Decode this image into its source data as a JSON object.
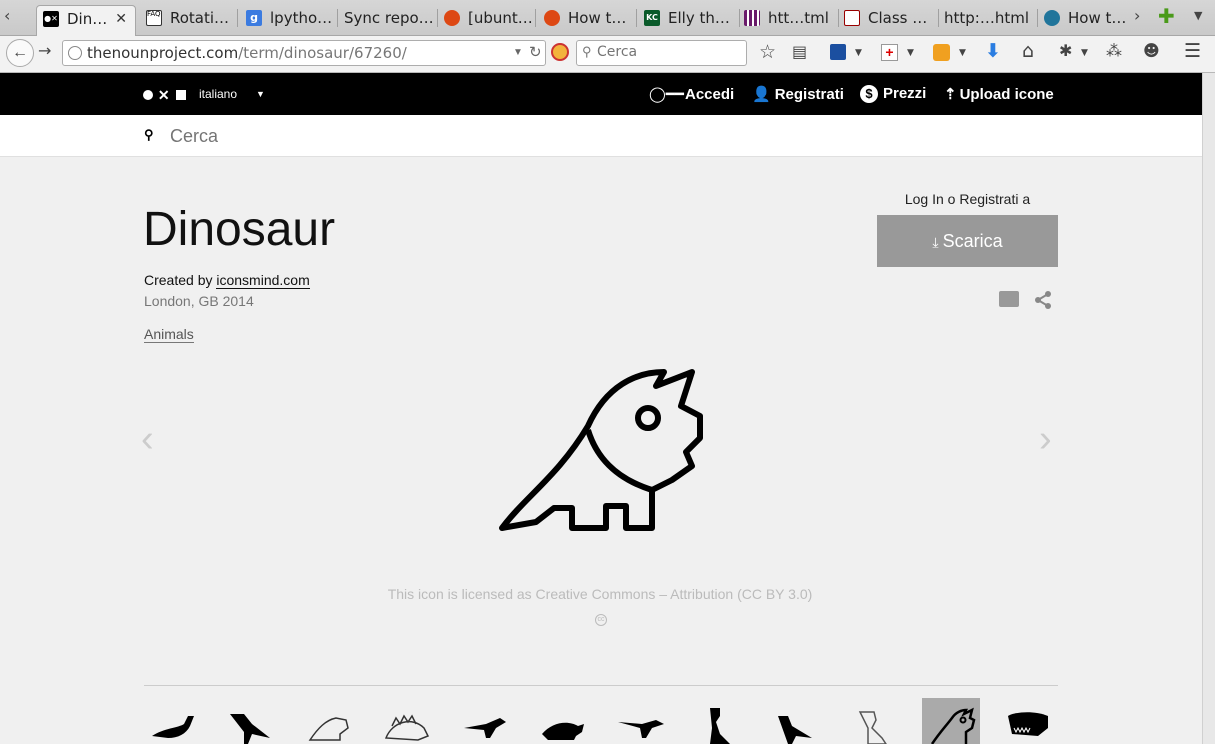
{
  "browser": {
    "tabs": [
      {
        "label": "Din…",
        "active": true
      },
      {
        "label": "Rotati…"
      },
      {
        "label": "lpytho…"
      },
      {
        "label": "Sync repo…"
      },
      {
        "label": "[ubunt…"
      },
      {
        "label": "How t…"
      },
      {
        "label": "Elly th…"
      },
      {
        "label": "htt…tml"
      },
      {
        "label": "Class …"
      },
      {
        "label": "http:…html"
      },
      {
        "label": "How t…"
      }
    ],
    "url_host": "thenounproject.com",
    "url_path": "/term/dinosaur/67260/",
    "search_placeholder": "Cerca",
    "colors": {
      "ubuntu": "#dd4814",
      "accent_blue": "#2a7de1"
    }
  },
  "site": {
    "language": "italiano",
    "nav": {
      "login": "Accedi",
      "signup": "Registrati",
      "pricing": "Prezzi",
      "upload": "Upload icone"
    },
    "search_placeholder": "Cerca"
  },
  "icon": {
    "title": "Dinosaur",
    "created_by_prefix": "Created by",
    "creator": "iconsmind.com",
    "location": "London, GB 2014",
    "tag": "Animals",
    "login_prompt": "Log In o Registrati a",
    "download_label": "Scarica",
    "license": "This icon is licensed as Creative Commons – Attribution (CC BY 3.0)",
    "license_badge": "cc"
  },
  "related": [
    "brachiosaurus-icon",
    "tyrannosaurus-icon",
    "triceratops-outline-icon",
    "stegosaurus-icon",
    "pteranodon-icon",
    "triceratops-icon",
    "raptor-icon",
    "t-rex-standing-icon",
    "dino-walking-icon",
    "t-rex-outline-icon",
    "triceratops-selected-icon",
    "t-rex-skull-icon"
  ]
}
